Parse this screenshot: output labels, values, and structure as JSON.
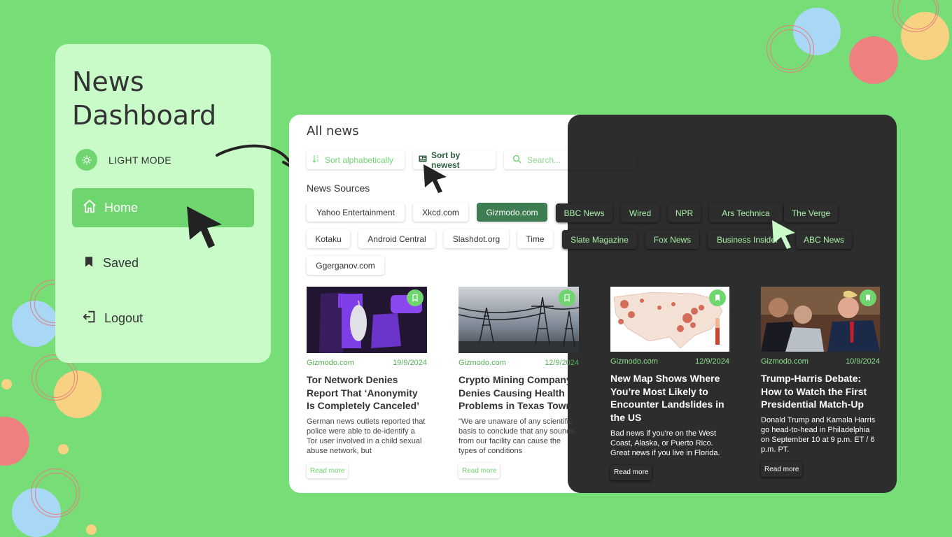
{
  "sidebar": {
    "title": "News Dashboard",
    "mode_label": "LIGHT MODE",
    "items": [
      {
        "label": "Home",
        "icon": "home-icon"
      },
      {
        "label": "Saved",
        "icon": "bookmark-icon"
      },
      {
        "label": "Logout",
        "icon": "logout-icon"
      }
    ]
  },
  "main": {
    "title": "All news",
    "toolbar": {
      "sort_alpha": "Sort alphabetically",
      "sort_newest": "Sort by newest",
      "search_placeholder": "Search..."
    },
    "sources_title": "News Sources",
    "sources": [
      "Yahoo Entertainment",
      "Xkcd.com",
      "Gizmodo.com",
      "BBC News",
      "Wired",
      "NPR",
      "Ars Technica",
      "The Verge",
      "Kotaku",
      "Android Central",
      "Slashdot.org",
      "Time",
      "Slate Magazine",
      "Fox News",
      "Business Insider",
      "ABC News",
      "Ggerganov.com"
    ],
    "active_source": "Gizmodo.com",
    "articles": [
      {
        "source": "Gizmodo.com",
        "date": "19/9/2024",
        "title": "Tor Network Denies Report That ‘Anonymity Is Completely Canceled’",
        "desc": "German news outlets reported that police were able to de-identify a Tor user involved in a child sexual abuse network, but",
        "read_more": "Read more"
      },
      {
        "source": "Gizmodo.com",
        "date": "12/9/2024",
        "title": "Crypto Mining Company Denies Causing Health Problems in Texas Town",
        "desc": "\"We are unaware of any scientific basis to conclude that any sounds from our facility can cause the types of conditions",
        "read_more": "Read more"
      },
      {
        "source": "Gizmodo.com",
        "date": "12/9/2024",
        "title": "New Map Shows Where You’re Most Likely to Encounter Landslides in the US",
        "desc": "Bad news if you're on the West Coast, Alaska, or Puerto Rico. Great news if you live in Florida.",
        "read_more": "Read more"
      },
      {
        "source": "Gizmodo.com",
        "date": "10/9/2024",
        "title": "Trump-Harris Debate: How to Watch the First Presidential Match-Up",
        "desc": "Donald Trump and Kamala Harris go head-to-head in Philadelphia on September 10 at 9 p.m. ET / 6 p.m. PT.",
        "read_more": "Read more"
      }
    ]
  },
  "colors": {
    "background": "#77de77",
    "accent": "#6fd66f",
    "active_chip": "#3e7d52",
    "dark_panel": "#2d2d2d",
    "sidebar_card": "#c9fbc9"
  }
}
